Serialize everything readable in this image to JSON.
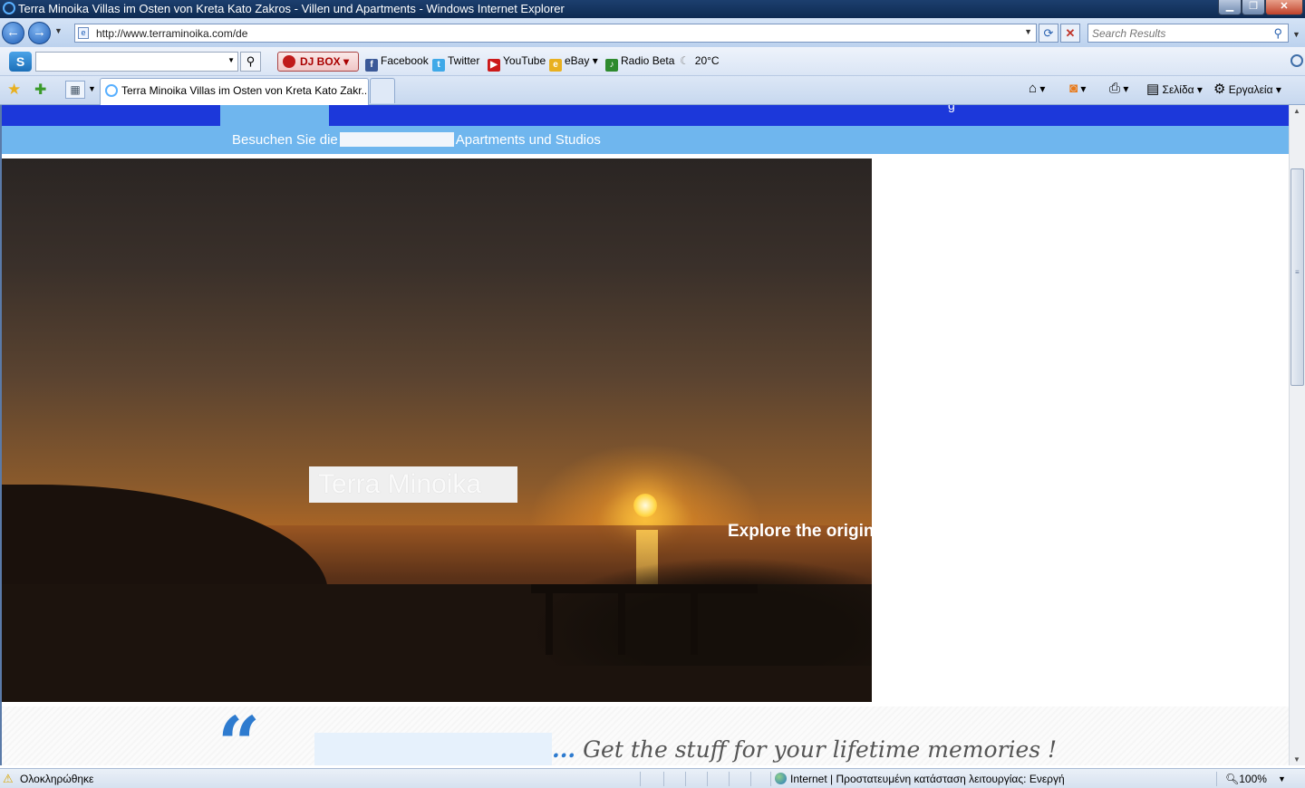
{
  "window": {
    "title": "Terra Minoika Villas im Osten von Kreta Kato Zakros - Villen und Apartments - Windows Internet Explorer",
    "controls": {
      "minimize": "▁",
      "maximize": "❐",
      "close": "✕"
    }
  },
  "address_bar": {
    "url": "http://www.terraminoika.com/de",
    "search_placeholder": "Search Results"
  },
  "toolbar": {
    "djbox_label": "DJ BOX",
    "links": [
      {
        "label": "Facebook",
        "icon": "facebook-icon",
        "color": "#3b5998"
      },
      {
        "label": "Twitter",
        "icon": "twitter-icon",
        "color": "#3fa9e8"
      },
      {
        "label": "YouTube",
        "icon": "youtube-icon",
        "color": "#cc1a1a"
      },
      {
        "label": "eBay",
        "icon": "ebay-icon",
        "color": "#e8b020"
      },
      {
        "label": "Radio Beta",
        "icon": "radio-icon",
        "color": "#2e8a2e"
      },
      {
        "label": "20°C",
        "icon": "weather-moon-icon",
        "color": "#777777"
      }
    ]
  },
  "tabs": {
    "active_title": "Terra Minoika Villas im Osten von Kreta Kato Zakr...",
    "commands": {
      "page": "Σελίδα",
      "tools": "Εργαλεία"
    }
  },
  "page": {
    "nav_partial": "g",
    "subnav": {
      "before": "Besuchen Sie die",
      "after": "Apartments und Studios"
    },
    "hero": {
      "title": "Terra Minoika",
      "tagline": "Explore the origin"
    },
    "quote": {
      "mark": "“",
      "dots": "...",
      "text": " Get the stuff for your lifetime memories !"
    },
    "colors": {
      "nav": "#1c38da",
      "subnav": "#6fb6ee",
      "quote_accent": "#2e7bcf"
    }
  },
  "status_bar": {
    "text": "Ολοκληρώθηκε",
    "zone": "Internet | Προστατευμένη κατάσταση λειτουργίας: Ενεργή",
    "zoom": "100%"
  }
}
